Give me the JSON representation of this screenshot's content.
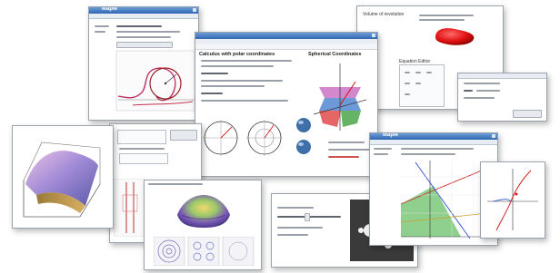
{
  "windows": {
    "w1": {
      "brand": "Maple"
    },
    "w2": {
      "section_title": "Calculus with polar coordinates",
      "panel_title": "Spherical Coordinates"
    },
    "w3": {
      "label": "Volume of revolution"
    },
    "w5": {
      "brand": "Maple"
    }
  },
  "colors": {
    "titlebar": "#2f66b3",
    "accent_red": "#e01010",
    "green_region": "#8fd08f"
  }
}
